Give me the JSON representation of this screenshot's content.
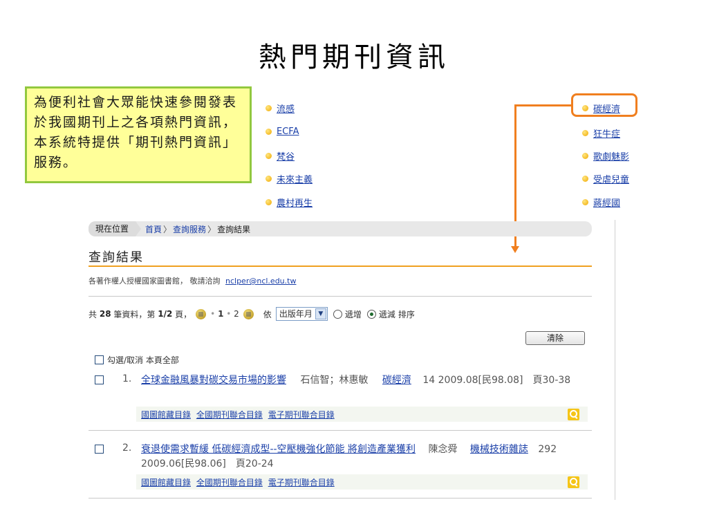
{
  "slide": {
    "title": "熱門期刊資訊",
    "callout": "為便利社會大眾能快速參閱發表於我國期刊上之各項熱門資訊，本系統特提供「期刊熱門資訊」服務。"
  },
  "hot_topics": {
    "left": [
      "流感",
      "ECFA",
      "梵谷",
      "未來主義",
      "農村再生"
    ],
    "right": [
      "碳經濟",
      "狂牛症",
      "歌劇魅影",
      "受虐兒童",
      "蔣經國"
    ]
  },
  "breadcrumb": {
    "here": "現在位置",
    "home": "首頁",
    "sep": "〉",
    "service": "查詢服務",
    "current": "查詢結果"
  },
  "result": {
    "title": "查詢結果",
    "copyright_prefix": "各著作權人授權國家圖書館，  敬請洽詢",
    "email": "nclper@ncl.edu.tw"
  },
  "paging": {
    "prefix": "共",
    "total": "28",
    "mid": "筆資料，第",
    "page": "1/2",
    "suffix": "頁，",
    "p1": "1",
    "p2": "2",
    "sort_by": "依",
    "sort_field": "出版年月",
    "asc": "遞增",
    "desc": "遞減",
    "sort_label": "排序",
    "dot": "•"
  },
  "buttons": {
    "clear": "清除"
  },
  "select_all": "勾選/取消 本頁全部",
  "records": [
    {
      "num": "1.",
      "title": "全球金融風暴對碳交易市場的影響",
      "authors": "石信智；林惠敏",
      "journal": "碳經濟",
      "rest": "14 2009.08[民98.08]　頁30-38",
      "links": [
        "國圖館藏目錄",
        "全國期刊聯合目錄",
        "電子期刊聯合目錄"
      ]
    },
    {
      "num": "2.",
      "title": "衰退使需求暫緩 低碳經濟成型--空壓機強化節能 將創造產業獲利",
      "authors": "陳念舜",
      "journal": "機械技術雜誌",
      "rest": "292 2009.06[民98.06]　頁20-24",
      "links": [
        "國圖館藏目錄",
        "全國期刊聯合目錄",
        "電子期刊聯合目錄"
      ]
    }
  ],
  "colors": {
    "callout_bg": "#ffff99",
    "callout_border": "#92c83e",
    "accent_orange": "#f07f1f",
    "link": "#1a3fa8"
  },
  "icons": [
    "bullet-dot-icon",
    "prev-page-icon",
    "next-page-icon",
    "dropdown-arrow-icon",
    "magnifier-icon"
  ]
}
